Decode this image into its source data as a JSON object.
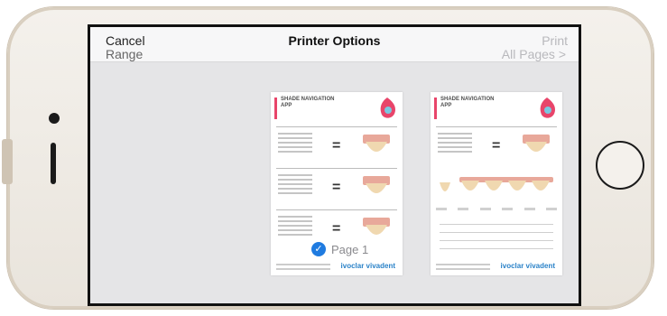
{
  "nav": {
    "cancel_label": "Cancel",
    "title": "Printer Options",
    "print_label": "Print",
    "behind_left": "Range",
    "behind_right": "All Pages >"
  },
  "preview": {
    "page_indicator": "Page 1",
    "page_heading": "SHADE NAVIGATION APP",
    "brand_logo_text": "ivoclar vivadent"
  },
  "colors": {
    "accent": "#1f7be0",
    "brand_pink": "#e8456a",
    "brand_blue": "#2a82c8",
    "disabled_text": "#b8b8bc"
  }
}
